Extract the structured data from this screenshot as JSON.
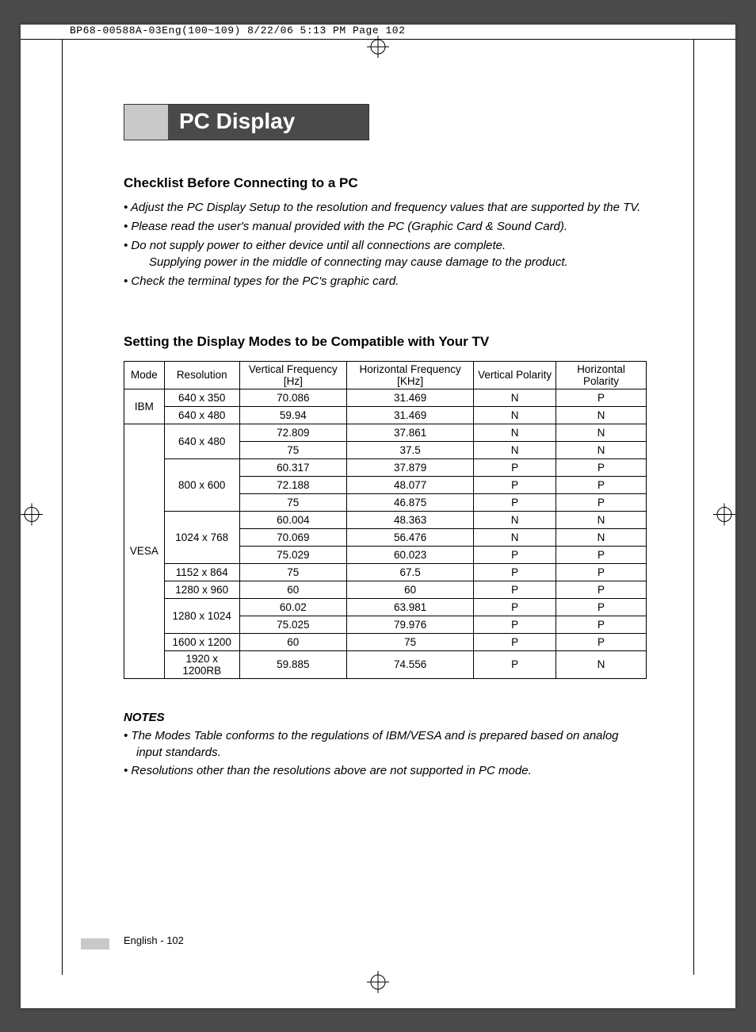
{
  "slug": "BP68-00588A-03Eng(100~109)  8/22/06  5:13 PM  Page 102",
  "title": "PC Display",
  "section1": {
    "heading": "Checklist Before Connecting to a PC",
    "bullets": [
      {
        "text": "Adjust the PC Display Setup to the resolution and frequency values that are supported by the TV."
      },
      {
        "text": "Please read the user's manual provided with the PC (Graphic Card & Sound Card)."
      },
      {
        "text": "Do not supply power to either device until all connections are complete.",
        "cont": "Supplying power in the middle of connecting may cause damage to the product."
      },
      {
        "text": "Check the terminal types for the PC's graphic card."
      }
    ]
  },
  "section2": {
    "heading": "Setting the Display Modes to be Compatible with Your TV",
    "columns": [
      "Mode",
      "Resolution",
      "Vertical Frequency [Hz]",
      "Horizontal Frequency [KHz]",
      "Vertical Polarity",
      "Horizontal Polarity"
    ],
    "groups": [
      {
        "mode": "IBM",
        "rows": [
          {
            "res": "640 x 350",
            "vf": "70.086",
            "hf": "31.469",
            "vp": "N",
            "hp": "P"
          },
          {
            "res": "640 x 480",
            "vf": "59.94",
            "hf": "31.469",
            "vp": "N",
            "hp": "N"
          }
        ]
      },
      {
        "mode": "VESA",
        "rows": [
          {
            "res": "640 x 480",
            "vf": "72.809",
            "hf": "37.861",
            "vp": "N",
            "hp": "N",
            "res_span": 2
          },
          {
            "res": "",
            "vf": "75",
            "hf": "37.5",
            "vp": "N",
            "hp": "N"
          },
          {
            "res": "800 x 600",
            "vf": "60.317",
            "hf": "37.879",
            "vp": "P",
            "hp": "P",
            "res_span": 3
          },
          {
            "res": "",
            "vf": "72.188",
            "hf": "48.077",
            "vp": "P",
            "hp": "P"
          },
          {
            "res": "",
            "vf": "75",
            "hf": "46.875",
            "vp": "P",
            "hp": "P"
          },
          {
            "res": "1024 x 768",
            "vf": "60.004",
            "hf": "48.363",
            "vp": "N",
            "hp": "N",
            "res_span": 3
          },
          {
            "res": "",
            "vf": "70.069",
            "hf": "56.476",
            "vp": "N",
            "hp": "N"
          },
          {
            "res": "",
            "vf": "75.029",
            "hf": "60.023",
            "vp": "P",
            "hp": "P"
          },
          {
            "res": "1152 x 864",
            "vf": "75",
            "hf": "67.5",
            "vp": "P",
            "hp": "P"
          },
          {
            "res": "1280 x 960",
            "vf": "60",
            "hf": "60",
            "vp": "P",
            "hp": "P"
          },
          {
            "res": "1280 x 1024",
            "vf": "60.02",
            "hf": "63.981",
            "vp": "P",
            "hp": "P",
            "res_span": 2
          },
          {
            "res": "",
            "vf": "75.025",
            "hf": "79.976",
            "vp": "P",
            "hp": "P"
          },
          {
            "res": "1600 x 1200",
            "vf": "60",
            "hf": "75",
            "vp": "P",
            "hp": "P"
          },
          {
            "res": "1920 x 1200RB",
            "vf": "59.885",
            "hf": "74.556",
            "vp": "P",
            "hp": "N"
          }
        ]
      }
    ]
  },
  "notes": {
    "heading": "NOTES",
    "items": [
      "The Modes Table conforms to the regulations of IBM/VESA and is prepared based on analog input standards.",
      "Resolutions other than the resolutions above are not supported in PC mode."
    ]
  },
  "footer": "English - 102"
}
